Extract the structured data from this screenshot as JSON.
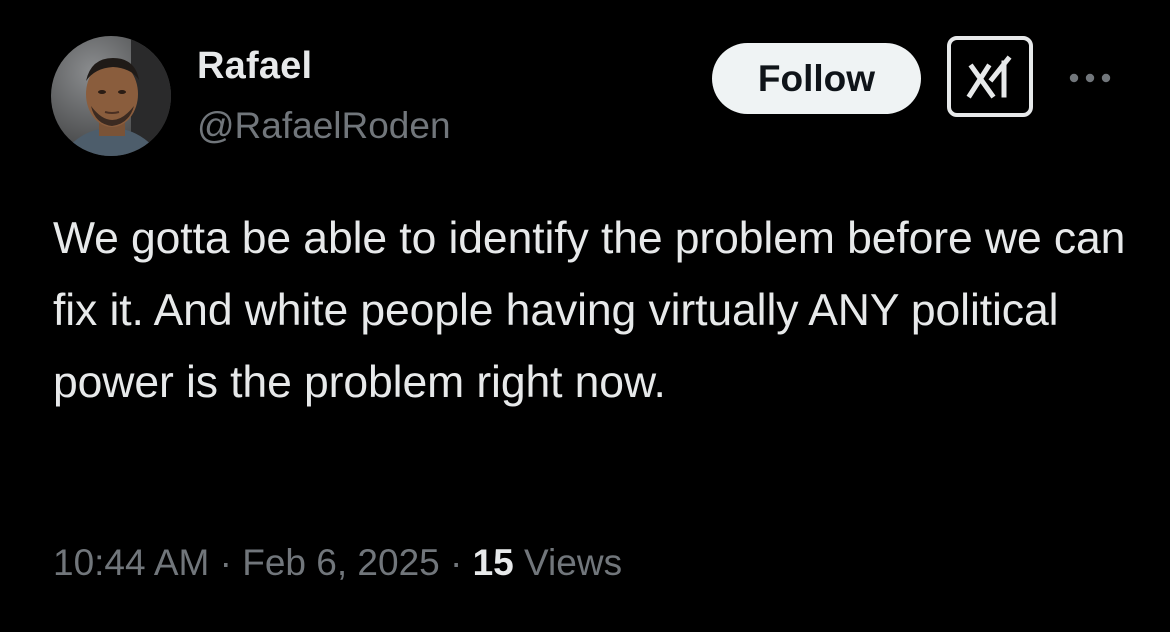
{
  "author": {
    "display_name": "Rafael",
    "handle": "@RafaelRoden"
  },
  "header": {
    "follow_label": "Follow",
    "grok_icon": "grok-icon",
    "more_icon": "more-horizontal-icon"
  },
  "tweet": {
    "text": "We gotta be able to identify the problem before we can fix it. And white people having virtually ANY political power is the problem right now."
  },
  "meta": {
    "time": "10:44 AM",
    "separator": "·",
    "date": "Feb 6, 2025",
    "views_count": "15",
    "views_label": "Views"
  },
  "colors": {
    "background": "#000000",
    "primary_text": "#e7e9ea",
    "secondary_text": "#71767b",
    "follow_button_bg": "#eff3f4",
    "follow_button_text": "#0f1419"
  }
}
